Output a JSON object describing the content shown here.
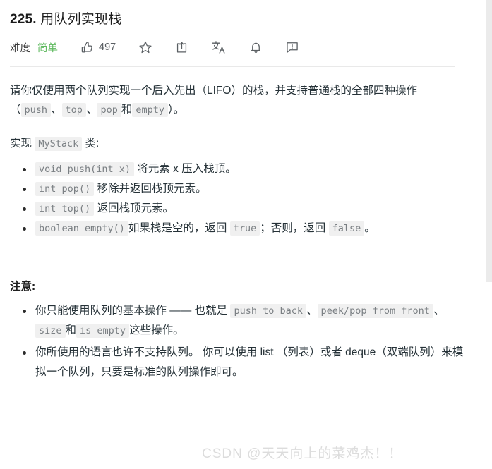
{
  "problem": {
    "number": "225.",
    "title": "用队列实现栈",
    "difficulty_label": "难度",
    "difficulty_value": "简单",
    "like_count": "497"
  },
  "toolbar": {
    "like_icon": "thumbs-up-icon",
    "favorite_icon": "star-icon",
    "share_icon": "share-icon",
    "translate_icon": "translate-icon",
    "notify_icon": "bell-icon",
    "report_icon": "report-icon"
  },
  "description": {
    "p1_a": "请你仅使用两个队列实现一个后入先出（LIFO）的栈，并支持普通栈的全部四种操作（",
    "p1_code1": "push",
    "p1_b": "、",
    "p1_code2": "top",
    "p1_c": "、",
    "p1_code3": "pop",
    "p1_d": "和",
    "p1_code4": "empty",
    "p1_e": "）。",
    "p2_a": "实现",
    "p2_code": "MyStack",
    "p2_b": "类:"
  },
  "methods": [
    {
      "code": "void push(int x)",
      "text": "将元素 x 压入栈顶。"
    },
    {
      "code": "int pop()",
      "text": "移除并返回栈顶元素。"
    },
    {
      "code": "int top()",
      "text": "返回栈顶元素。"
    }
  ],
  "method_empty": {
    "code": "boolean empty()",
    "text_a": "如果栈是空的，返回",
    "code_true": "true",
    "text_b": "；否则，返回",
    "code_false": "false",
    "text_c": "。"
  },
  "notice": {
    "title": "注意:",
    "item1_a": "你只能使用队列的基本操作 —— 也就是",
    "item1_code1": "push to back",
    "item1_b": "、",
    "item1_code2": "peek/pop from front",
    "item1_c": "、",
    "item1_code3": "size",
    "item1_d": "和",
    "item1_code4": "is empty",
    "item1_e": "这些操作。",
    "item2": "你所使用的语言也许不支持队列。 你可以使用 list （列表）或者 deque（双端队列）来模拟一个队列，只要是标准的队列操作即可。"
  },
  "watermark": {
    "text": "CSDN @天天向上的菜鸡杰！！"
  }
}
